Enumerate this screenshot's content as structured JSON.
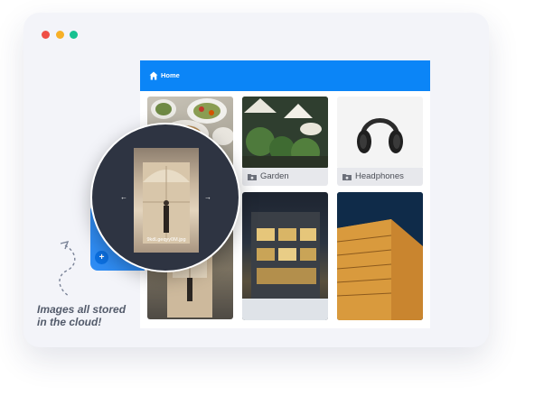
{
  "window_controls": [
    "close",
    "minimize",
    "maximize"
  ],
  "header": {
    "title": "Home",
    "icon": "home-icon",
    "color": "#0b85f7"
  },
  "folders": [
    {
      "label": "Garden",
      "icon": "folder-image-icon"
    },
    {
      "label": "Headphones",
      "icon": "folder-image-icon"
    }
  ],
  "preview": {
    "filename": "9kdLgeqyy0M.jpg",
    "prev_icon": "arrow-left-icon",
    "next_icon": "arrow-right-icon"
  },
  "add_button": {
    "icon": "plus-icon"
  },
  "caption": {
    "line1": "Images all stored",
    "line2": "in the cloud!"
  },
  "colors": {
    "accent": "#0b85f7",
    "close": "#ef4f46",
    "minimize": "#f7b027",
    "maximize": "#16c191"
  }
}
